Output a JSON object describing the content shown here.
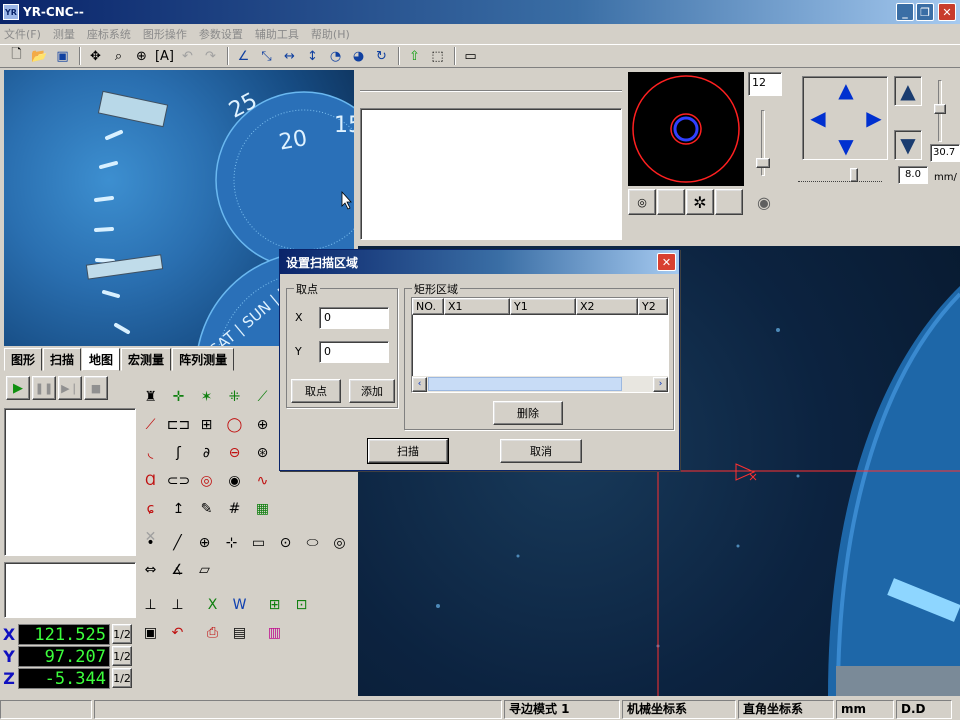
{
  "window": {
    "title": "YR-CNC--",
    "icon_text": "YR"
  },
  "menu": [
    "文件(F)",
    "测量",
    "座标系统",
    "图形操作",
    "参数设置",
    "辅助工具",
    "帮助(H)"
  ],
  "camera": {
    "dial_numbers": [
      "25",
      "20",
      "15"
    ],
    "dial_text": "SAT | SUN | MO"
  },
  "zoom": {
    "value": "12",
    "readout": "30.7",
    "speed_value": "8.0",
    "speed_unit": "mm/"
  },
  "tabs": [
    "图形",
    "扫描",
    "地图",
    "宏测量",
    "阵列测量"
  ],
  "coords": [
    {
      "axis": "X",
      "value": "121.525",
      "half": "1/2"
    },
    {
      "axis": "Y",
      "value": "97.207",
      "half": "1/2"
    },
    {
      "axis": "Z",
      "value": "-5.344",
      "half": "1/2"
    }
  ],
  "dialog": {
    "title": "设置扫描区域",
    "pick_group": "取点",
    "x_label": "X",
    "x_value": "0",
    "y_label": "Y",
    "y_value": "0",
    "pick_button": "取点",
    "add_button": "添加",
    "rect_group": "矩形区域",
    "columns": [
      "NO.",
      "X1",
      "Y1",
      "X2",
      "Y2"
    ],
    "delete_button": "删除",
    "scan_button": "扫描",
    "cancel_button": "取消"
  },
  "status": [
    "寻边模式 1",
    "机械坐标系",
    "直角坐标系",
    "mm",
    "D.D"
  ],
  "colors": {
    "title_start": "#0a246a",
    "title_end": "#a6caf0",
    "readout_text": "#3cff3c",
    "crosshair": "#ff3030"
  }
}
